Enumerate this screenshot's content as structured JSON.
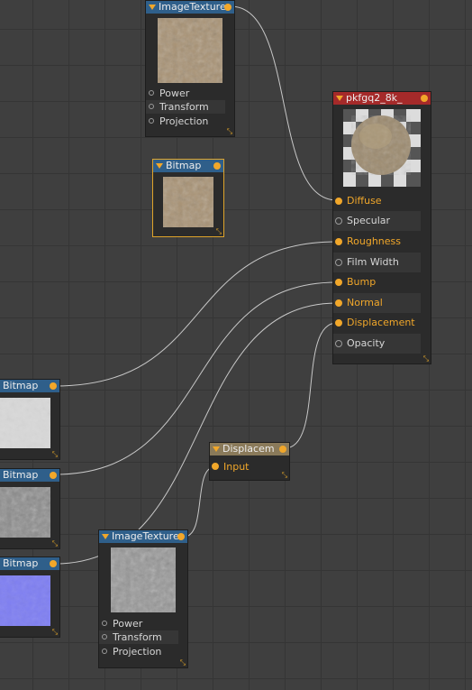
{
  "nodes": {
    "image_texture_top": {
      "title": "ImageTexture",
      "inputs": [
        {
          "label": "Power"
        },
        {
          "label": "Transform"
        },
        {
          "label": "Projection"
        }
      ]
    },
    "bitmap_floating": {
      "title": "Bitmap"
    },
    "material": {
      "title": "pkfgq2_8k_",
      "inputs": [
        {
          "label": "Diffuse",
          "linked": true
        },
        {
          "label": "Specular",
          "linked": false
        },
        {
          "label": "Roughness",
          "linked": true
        },
        {
          "label": "Film Width",
          "linked": false
        },
        {
          "label": "Bump",
          "linked": true
        },
        {
          "label": "Normal",
          "linked": true
        },
        {
          "label": "Displacement",
          "linked": true
        },
        {
          "label": "Opacity",
          "linked": false
        }
      ]
    },
    "bitmap_white": {
      "title": "Bitmap"
    },
    "bitmap_gray": {
      "title": "Bitmap"
    },
    "bitmap_normal": {
      "title": "Bitmap"
    },
    "displacement": {
      "title": "Displacem",
      "input_label": "Input"
    },
    "image_texture_bottom": {
      "title": "ImageTexture",
      "inputs": [
        {
          "label": "Power"
        },
        {
          "label": "Transform"
        },
        {
          "label": "Projection"
        }
      ]
    }
  },
  "colors": {
    "accent": "#f1a72a",
    "header_blue": "#2f5f8a",
    "header_red": "#a52a2a",
    "header_tan": "#8a7a5a",
    "wire": "#c8c8c8"
  }
}
